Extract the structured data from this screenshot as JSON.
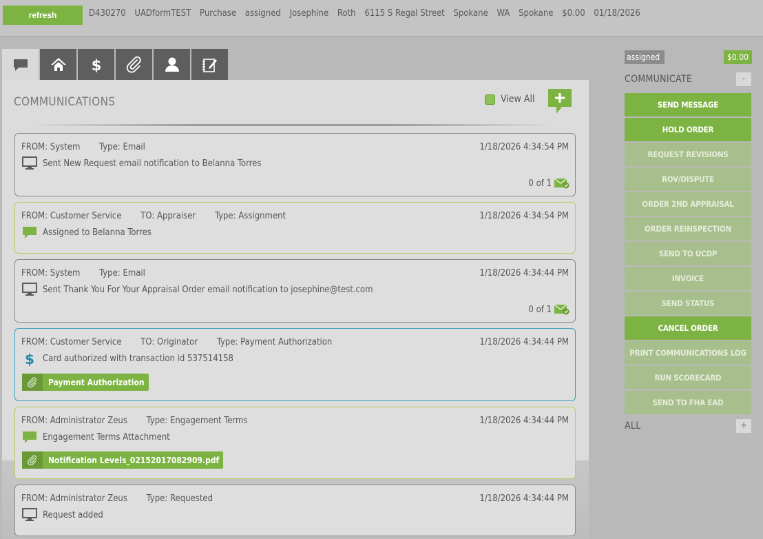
{
  "topbar": {
    "refresh_label": "refresh",
    "order_fields": [
      "D430270",
      "UADformTEST",
      "Purchase",
      "assigned",
      "Josephine",
      "Roth",
      "6115 S Regal Street",
      "Spokane",
      "WA",
      "Spokane",
      "$0.00",
      "01/18/2026"
    ]
  },
  "tabs": [
    {
      "name": "messages-tab",
      "icon": "speech-bubble-icon"
    },
    {
      "name": "property-tab",
      "icon": "home-icon"
    },
    {
      "name": "fees-tab",
      "icon": "dollar-icon"
    },
    {
      "name": "attachments-tab",
      "icon": "paperclip-icon"
    },
    {
      "name": "contacts-tab",
      "icon": "person-icon"
    },
    {
      "name": "notes-tab",
      "icon": "notepad-icon"
    }
  ],
  "communications": {
    "title": "COMMUNICATIONS",
    "view_all_label": "View All",
    "add_icon": "add-message-icon",
    "messages": [
      {
        "from": "FROM: System",
        "to": "",
        "type": "Type: Email",
        "date": "1/18/2026 4:34:54 PM",
        "text": "Sent New Request email notification to Belanna Torres",
        "icon": "monitor-icon",
        "count": "0 of 1",
        "attachment": ""
      },
      {
        "from": "FROM: Customer Service",
        "to": "TO: Appraiser",
        "type": "Type: Assignment",
        "date": "1/18/2026 4:34:54 PM",
        "text": "Assigned to Belanna Torres",
        "icon": "speech-bubble-icon",
        "count": "",
        "attachment": ""
      },
      {
        "from": "FROM: System",
        "to": "",
        "type": "Type: Email",
        "date": "1/18/2026 4:34:44 PM",
        "text": "Sent Thank You For Your Appraisal Order email notification to josephine@test.com",
        "icon": "monitor-icon",
        "count": "0 of 1",
        "attachment": ""
      },
      {
        "from": "FROM: Customer Service",
        "to": "TO: Originator",
        "type": "Type: Payment Authorization",
        "date": "1/18/2026 4:34:44 PM",
        "text": "Card authorized with transaction id 537514158",
        "icon": "dollar-icon",
        "count": "",
        "attachment": "Payment Authorization"
      },
      {
        "from": "FROM: Administrator Zeus",
        "to": "",
        "type": "Type: Engagement Terms",
        "date": "1/18/2026 4:34:44 PM",
        "text": "Engagement Terms Attachment",
        "icon": "speech-bubble-icon",
        "count": "",
        "attachment": "Notification Levels_02152017082909.pdf"
      },
      {
        "from": "FROM: Administrator Zeus",
        "to": "",
        "type": "Type: Requested",
        "date": "1/18/2026 4:34:44 PM",
        "text": "Request added",
        "icon": "monitor-icon",
        "count": "",
        "attachment": ""
      }
    ]
  },
  "sidebar": {
    "status_badge": "assigned",
    "amount_badge": "$0.00",
    "communicate_label": "COMMUNICATE",
    "communicate_toggle": "-",
    "all_label": "ALL",
    "all_toggle": "+",
    "actions": [
      {
        "label": "SEND MESSAGE",
        "enabled": true
      },
      {
        "label": "HOLD ORDER",
        "enabled": true
      },
      {
        "label": "REQUEST REVISIONS",
        "enabled": false
      },
      {
        "label": "ROV/DISPUTE",
        "enabled": false
      },
      {
        "label": "ORDER 2ND APPRAISAL",
        "enabled": false
      },
      {
        "label": "ORDER REINSPECTION",
        "enabled": false
      },
      {
        "label": "SEND TO UCDP",
        "enabled": false
      },
      {
        "label": "INVOICE",
        "enabled": false
      },
      {
        "label": "SEND STATUS",
        "enabled": false
      },
      {
        "label": "CANCEL ORDER",
        "enabled": true
      },
      {
        "label": "PRINT COMMUNICATIONS LOG",
        "enabled": false
      },
      {
        "label": "RUN SCORECARD",
        "enabled": false
      },
      {
        "label": "SEND TO FHA EAD",
        "enabled": false
      }
    ]
  },
  "colors": {
    "accent_green": "#7cb342",
    "disabled_green": "#a7bf8c",
    "border_blue": "#3ba0bd",
    "border_lime": "#b9cc5f"
  }
}
